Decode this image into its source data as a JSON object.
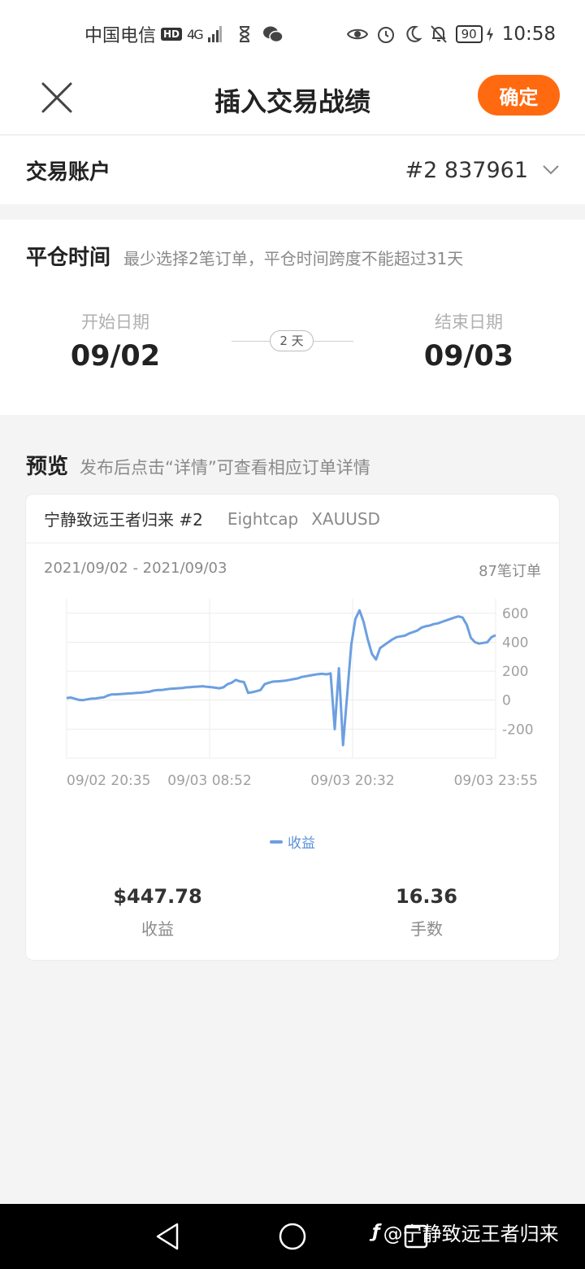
{
  "status_bar": {
    "carrier": "中国电信",
    "hd": "HD",
    "network": "4G",
    "battery": "90",
    "time": "10:58"
  },
  "header": {
    "title": "插入交易战绩",
    "confirm_label": "确定"
  },
  "account": {
    "label": "交易账户",
    "value": "#2 837961"
  },
  "close_time": {
    "label": "平仓时间",
    "hint": "最少选择2笔订单，平仓时间跨度不能超过31天",
    "start_caption": "开始日期",
    "start_value": "09/02",
    "span": "2 天",
    "end_caption": "结束日期",
    "end_value": "09/03"
  },
  "preview": {
    "label": "预览",
    "hint": "发布后点击“详情”可查看相应订单详情",
    "card": {
      "strategy_name": "宁静致远王者归来 #2",
      "broker": "Eightcap",
      "symbol": "XAUUSD",
      "date_range": "2021/09/02 - 2021/09/03",
      "order_count": "87笔订单",
      "profit_value": "$447.78",
      "profit_caption": "收益",
      "lots_value": "16.36",
      "lots_caption": "手数"
    }
  },
  "chart_data": {
    "type": "line",
    "series": [
      {
        "name": "收益",
        "color": "#6c9fe0",
        "values": [
          15,
          18,
          10,
          2,
          0,
          6,
          10,
          12,
          16,
          20,
          32,
          40,
          40,
          42,
          44,
          46,
          48,
          50,
          52,
          55,
          58,
          66,
          70,
          70,
          74,
          78,
          80,
          82,
          84,
          88,
          90,
          92,
          94,
          96,
          92,
          90,
          86,
          82,
          88,
          110,
          120,
          140,
          130,
          125,
          50,
          55,
          62,
          70,
          110,
          120,
          128,
          130,
          132,
          135,
          140,
          145,
          150,
          160,
          165,
          170,
          175,
          180,
          182,
          178,
          185,
          -200,
          220,
          -310,
          30,
          380,
          560,
          620,
          540,
          420,
          320,
          280,
          360,
          380,
          400,
          420,
          435,
          440,
          445,
          460,
          470,
          480,
          500,
          510,
          515,
          525,
          530,
          540,
          550,
          560,
          570,
          578,
          570,
          520,
          430,
          400,
          390,
          395,
          400,
          435,
          447.78
        ]
      }
    ],
    "y_ticks": [
      600,
      400,
      200,
      0,
      -200
    ],
    "ylim": [
      -400,
      700
    ],
    "x_tick_labels": [
      "09/02 20:35",
      "09/03 08:52",
      "09/03 20:32",
      "09/03 23:55"
    ],
    "legend": "收益",
    "legend_position": "bottom-center",
    "grid": true
  },
  "nav": {
    "watermark": "@宁静致远王者归来"
  },
  "icons": {
    "close": "close-icon",
    "chevron": "chevron-down-icon",
    "back": "nav-back-icon",
    "home": "nav-home-icon",
    "recent": "nav-recent-icon"
  },
  "colors": {
    "accent": "#ff6a10",
    "series": "#6c9fe0"
  }
}
